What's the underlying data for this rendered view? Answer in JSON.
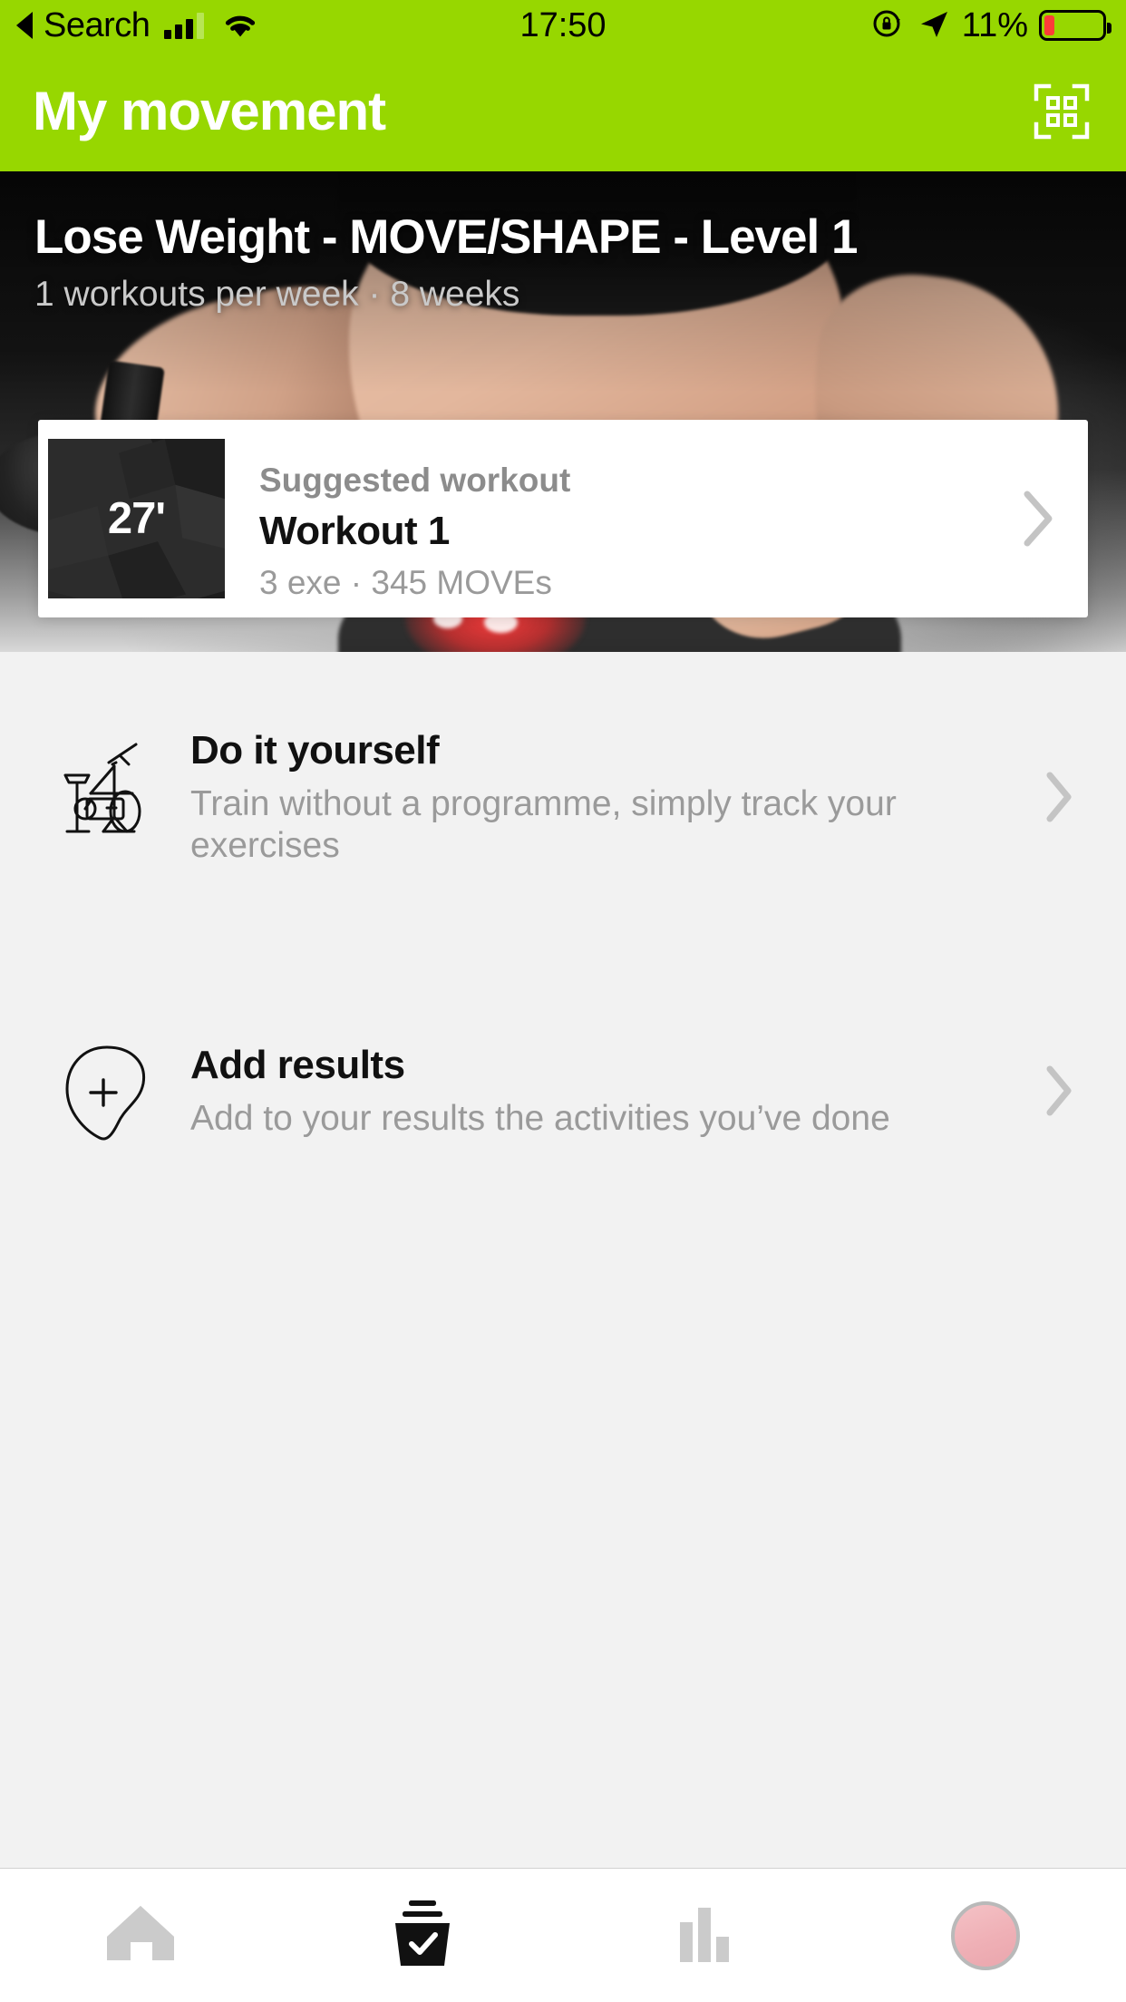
{
  "status_bar": {
    "back_label": "Search",
    "back_icon": "back-triangle-icon",
    "signal_icon": "cellular-signal-icon",
    "wifi_icon": "wifi-icon",
    "time": "17:50",
    "rotation_lock_icon": "rotation-lock-icon",
    "location_icon": "location-arrow-icon",
    "battery_percent": "11%",
    "battery_icon": "battery-low-icon",
    "background_color": "#97d700"
  },
  "header": {
    "title": "My movement",
    "qr_icon": "qr-scan-icon",
    "background_color": "#97d700",
    "title_color": "#ffffff"
  },
  "hero": {
    "title": "Lose Weight - MOVE/SHAPE - Level 1",
    "subtitle": "1 workouts per week · 8 weeks"
  },
  "suggested_card": {
    "duration": "27'",
    "kicker": "Suggested workout",
    "title": "Workout 1",
    "meta": "3 exe · 345 MOVEs",
    "chevron_icon": "chevron-right-icon"
  },
  "rows": [
    {
      "icon": "exercise-bike-icon",
      "title": "Do it yourself",
      "description": "Train without a programme, simply track your exercises",
      "chevron_icon": "chevron-right-icon"
    },
    {
      "icon": "add-pin-icon",
      "title": "Add results",
      "description": "Add to your results the activities you’ve done",
      "chevron_icon": "chevron-right-icon"
    }
  ],
  "tab_bar": {
    "items": [
      {
        "icon": "home-icon",
        "active": false
      },
      {
        "icon": "workout-basket-check-icon",
        "active": true
      },
      {
        "icon": "bar-chart-icon",
        "active": false
      },
      {
        "icon": "profile-avatar-icon",
        "active": false
      }
    ],
    "active_color": "#111111",
    "inactive_color": "#cbcbcb",
    "avatar_color": "#efb0b6"
  }
}
